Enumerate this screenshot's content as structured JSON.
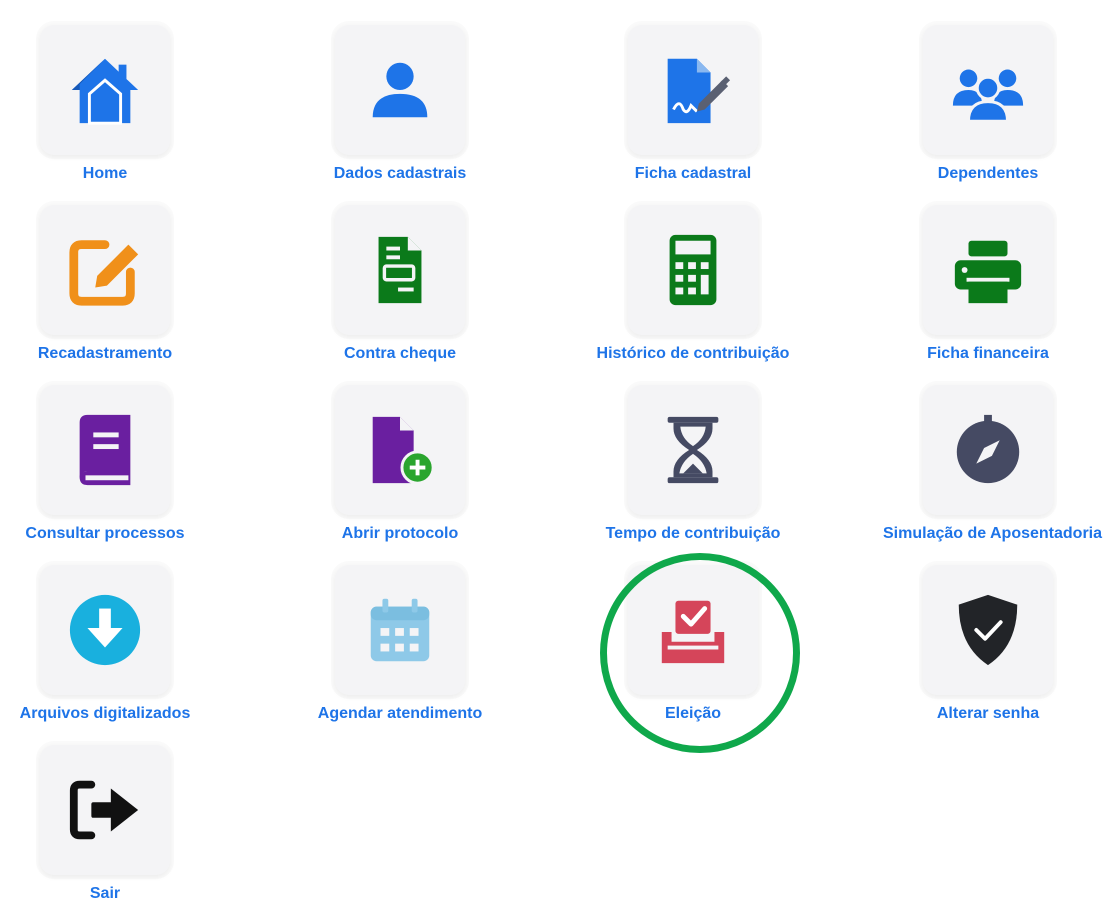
{
  "menu": {
    "items": [
      {
        "label": "Home",
        "icon": "home-icon"
      },
      {
        "label": "Dados cadastrais",
        "icon": "user-icon"
      },
      {
        "label": "Ficha cadastral",
        "icon": "signed-document-icon"
      },
      {
        "label": "Dependentes",
        "icon": "users-icon"
      },
      {
        "label": "Recadastramento",
        "icon": "edit-icon"
      },
      {
        "label": "Contra cheque",
        "icon": "paycheck-icon"
      },
      {
        "label": "Histórico de contribuição",
        "icon": "calculator-icon"
      },
      {
        "label": "Ficha financeira",
        "icon": "printer-icon"
      },
      {
        "label": "Consultar processos",
        "icon": "book-icon"
      },
      {
        "label": "Abrir protocolo",
        "icon": "add-file-icon"
      },
      {
        "label": "Tempo de contribuição",
        "icon": "hourglass-icon"
      },
      {
        "label": "Simulação de Aposentadoria",
        "icon": "compass-icon"
      },
      {
        "label": "Arquivos digitalizados",
        "icon": "download-icon"
      },
      {
        "label": "Agendar atendimento",
        "icon": "calendar-icon"
      },
      {
        "label": "Eleição",
        "icon": "vote-box-icon"
      },
      {
        "label": "Alterar senha",
        "icon": "shield-check-icon"
      },
      {
        "label": "Sair",
        "icon": "sign-out-icon"
      }
    ],
    "highlighted": "Eleição"
  },
  "colors": {
    "label": "#1e74e8",
    "highlight_ring": "#0fa84b",
    "blue": "#1e74e8",
    "orange": "#f0901a",
    "green": "#0b7a1a",
    "purple": "#6a1fa0",
    "slate": "#454a63",
    "cyan": "#19b0de",
    "light_blue": "#8ec9e8",
    "red": "#d5455a",
    "black": "#222428"
  }
}
